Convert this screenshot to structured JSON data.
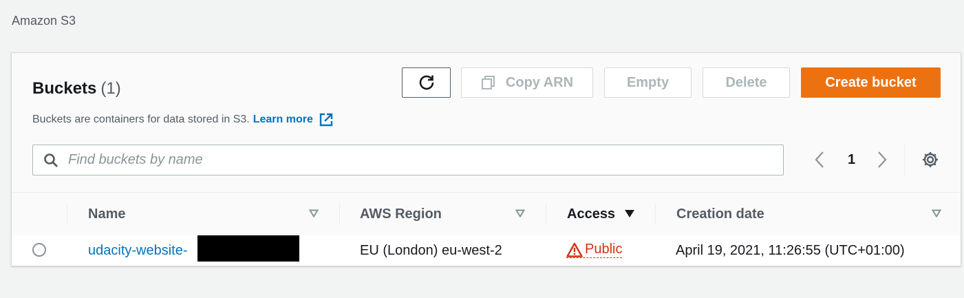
{
  "breadcrumb": "Amazon S3",
  "header": {
    "title": "Buckets",
    "count": "(1)",
    "description": "Buckets are containers for data stored in S3.",
    "learn_more": "Learn more"
  },
  "toolbar": {
    "copy_arn": "Copy ARN",
    "empty": "Empty",
    "delete": "Delete",
    "create_bucket": "Create bucket"
  },
  "search": {
    "placeholder": "Find buckets by name",
    "value": ""
  },
  "pagination": {
    "current_page": "1"
  },
  "table": {
    "columns": [
      "Name",
      "AWS Region",
      "Access",
      "Creation date"
    ],
    "sorted_column": "Access",
    "rows": [
      {
        "name": "udacity-website-",
        "region": "EU (London) eu-west-2",
        "access": "Public",
        "creation_date": "April 19, 2021, 11:26:55 (UTC+01:00)"
      }
    ]
  },
  "colors": {
    "primary": "#ec7211",
    "link": "#0073bb",
    "warning": "#d13212"
  }
}
